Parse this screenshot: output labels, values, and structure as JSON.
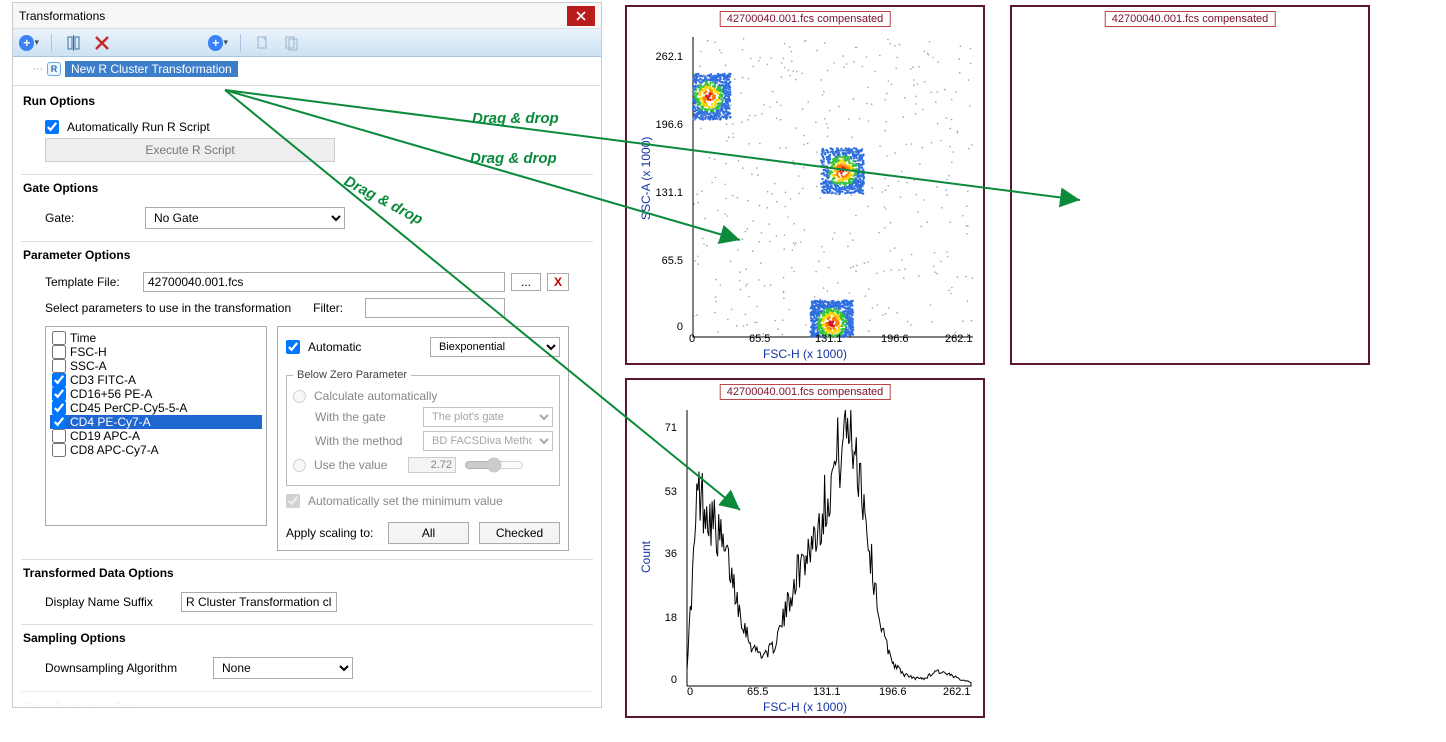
{
  "window": {
    "title": "Transformations"
  },
  "toolbar": {
    "add1": "+",
    "add2": "+"
  },
  "tree": {
    "r_badge": "R",
    "item_label": "New R Cluster Transformation"
  },
  "run_options": {
    "heading": "Run Options",
    "auto_run_label": "Automatically Run R Script",
    "auto_run_checked": true,
    "execute_btn": "Execute R Script"
  },
  "gate_options": {
    "heading": "Gate Options",
    "gate_label": "Gate:",
    "gate_value": "No Gate"
  },
  "param_options": {
    "heading": "Parameter Options",
    "template_label": "Template File:",
    "template_value": "42700040.001.fcs",
    "dots": "...",
    "x": "X",
    "select_params_label": "Select parameters to use in the transformation",
    "filter_label": "Filter:",
    "filter_value": "",
    "params": [
      {
        "name": "Time",
        "checked": false
      },
      {
        "name": "FSC-H",
        "checked": false
      },
      {
        "name": "SSC-A",
        "checked": false
      },
      {
        "name": "CD3 FITC-A",
        "checked": true
      },
      {
        "name": "CD16+56 PE-A",
        "checked": true
      },
      {
        "name": "CD45 PerCP-Cy5-5-A",
        "checked": true
      },
      {
        "name": "CD4 PE-Cy7-A",
        "checked": true,
        "selected": true
      },
      {
        "name": "CD19 APC-A",
        "checked": false
      },
      {
        "name": "CD8 APC-Cy7-A",
        "checked": false
      }
    ],
    "scaling": {
      "automatic_label": "Automatic",
      "automatic_checked": true,
      "type_value": "Biexponential",
      "bz_legend": "Below Zero Parameter",
      "calc_auto_label": "Calculate automatically",
      "with_gate_label": "With the gate",
      "with_gate_value": "The plot's gate",
      "with_method_label": "With the method",
      "with_method_value": "BD FACSDiva Method",
      "use_value_label": "Use the value",
      "use_value_value": "2.72",
      "auto_min_label": "Automatically set the minimum value",
      "apply_label": "Apply scaling to:",
      "apply_all": "All",
      "apply_checked": "Checked"
    }
  },
  "tdo": {
    "heading": "Transformed Data Options",
    "suffix_label": "Display Name Suffix",
    "suffix_value": "R Cluster Transformation clu"
  },
  "sampling": {
    "heading": "Sampling Options",
    "algo_label": "Downsampling Algorithm",
    "algo_value": "None"
  },
  "last_faded": "Transformation Options",
  "drag_drop": {
    "label": "Drag & drop"
  },
  "plots": {
    "title": "42700040.001.fcs compensated",
    "scatter": {
      "xlabel": "FSC-H (x 1000)",
      "ylabel": "SSC-A (x 1000)",
      "xticks": [
        "0",
        "65.5",
        "131.1",
        "196.6",
        "262.1"
      ],
      "yticks": [
        "0",
        "65.5",
        "131.1",
        "196.6",
        "262.1"
      ]
    },
    "hist": {
      "xlabel": "FSC-H (x 1000)",
      "ylabel": "Count",
      "xticks": [
        "0",
        "65.5",
        "131.1",
        "196.6",
        "262.1"
      ],
      "yticks": [
        "0",
        "18",
        "36",
        "53",
        "71"
      ]
    }
  },
  "chart_data": [
    {
      "type": "scatter",
      "title": "42700040.001.fcs compensated",
      "xlabel": "FSC-H (x 1000)",
      "ylabel": "SSC-A (x 1000)",
      "xlim": [
        0,
        262.1
      ],
      "ylim": [
        0,
        262.1
      ],
      "note": "density scatter; three main populations",
      "clusters": [
        {
          "cx": 15,
          "cy": 210,
          "approx_count": 4000
        },
        {
          "cx": 140,
          "cy": 145,
          "approx_count": 3500
        },
        {
          "cx": 130,
          "cy": 12,
          "approx_count": 5000
        }
      ]
    },
    {
      "type": "area",
      "title": "42700040.001.fcs compensated",
      "xlabel": "FSC-H (x 1000)",
      "ylabel": "Count",
      "xlim": [
        0,
        262.1
      ],
      "ylim": [
        0,
        71
      ],
      "x": [
        0,
        10,
        20,
        30,
        40,
        50,
        60,
        70,
        80,
        90,
        100,
        110,
        120,
        130,
        140,
        150,
        160,
        170,
        180,
        190,
        200,
        210,
        220,
        230,
        240,
        250,
        262
      ],
      "values": [
        5,
        50,
        45,
        38,
        30,
        18,
        10,
        8,
        10,
        18,
        28,
        34,
        40,
        50,
        60,
        68,
        55,
        32,
        14,
        6,
        3,
        2,
        2,
        4,
        3,
        2,
        1
      ]
    }
  ]
}
